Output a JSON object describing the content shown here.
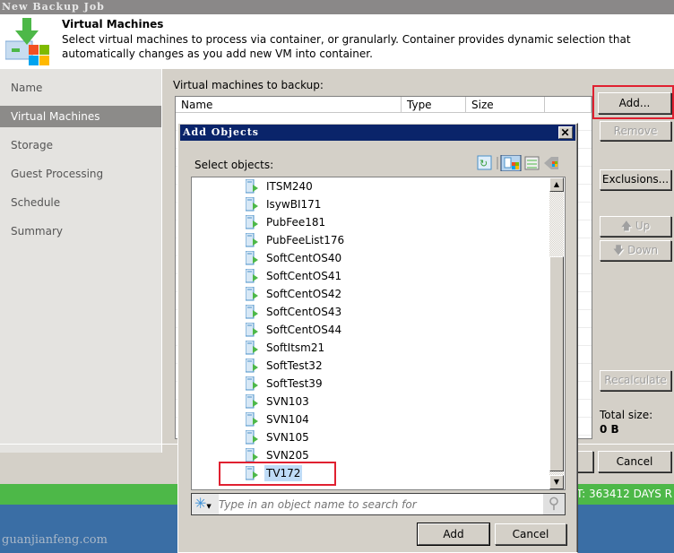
{
  "window": {
    "title": "New Backup Job"
  },
  "header": {
    "title": "Virtual Machines",
    "description": "Select virtual machines to process via container, or granularly. Container provides dynamic selection that automatically changes as you add new VM into container."
  },
  "sidebar": {
    "items": [
      {
        "label": "Name",
        "selected": false
      },
      {
        "label": "Virtual Machines",
        "selected": true
      },
      {
        "label": "Storage",
        "selected": false
      },
      {
        "label": "Guest Processing",
        "selected": false
      },
      {
        "label": "Schedule",
        "selected": false
      },
      {
        "label": "Summary",
        "selected": false
      }
    ]
  },
  "main": {
    "table_label": "Virtual machines to backup:",
    "columns": [
      "Name",
      "Type",
      "Size"
    ],
    "buttons": {
      "add": "Add...",
      "remove": "Remove",
      "exclusions": "Exclusions...",
      "up": "Up",
      "down": "Down",
      "recalculate": "Recalculate",
      "cancel": "Cancel"
    },
    "total_size_label": "Total size:",
    "total_size_value": "0 B"
  },
  "status_strip": {
    "text": "ORT: 363412 DAYS R",
    "color": "#4db848"
  },
  "watermark": "guanjianfeng.com",
  "dialog": {
    "title": "Add Objects",
    "close": "✕",
    "select_label": "Select objects:",
    "toolbar_icons": [
      "refresh-icon",
      "hosts-and-clusters-icon",
      "vms-and-templates-icon",
      "tags-icon"
    ],
    "items": [
      "ITSM240",
      "IsywBI171",
      "PubFee181",
      "PubFeeList176",
      "SoftCentOS40",
      "SoftCentOS41",
      "SoftCentOS42",
      "SoftCentOS43",
      "SoftCentOS44",
      "SoftItsm21",
      "SoftTest32",
      "SoftTest39",
      "SVN103",
      "SVN104",
      "SVN105",
      "SVN205",
      "TV172"
    ],
    "selected_item": "TV172",
    "search_placeholder": "Type in an object name to search for",
    "add_label": "Add",
    "cancel_label": "Cancel"
  },
  "colors": {
    "dialog_title": "#0a246a",
    "highlight": "#e02030",
    "selection": "#bfdcf7"
  }
}
